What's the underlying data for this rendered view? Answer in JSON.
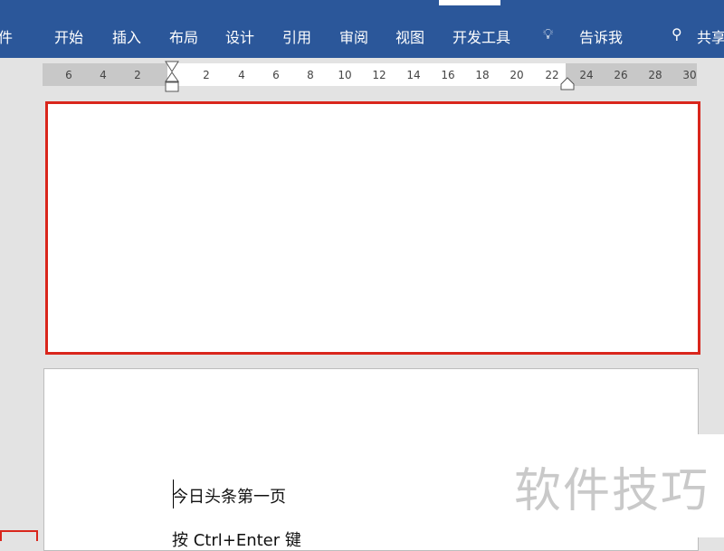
{
  "ribbon": {
    "tabs": [
      "件",
      "开始",
      "插入",
      "布局",
      "设计",
      "引用",
      "审阅",
      "视图",
      "开发工具"
    ],
    "tell_me": "告诉我",
    "share": "共享"
  },
  "ruler": {
    "ticks": [
      "6",
      "4",
      "2",
      "2",
      "4",
      "6",
      "8",
      "10",
      "12",
      "14",
      "16",
      "18",
      "20",
      "22",
      "24",
      "26",
      "28",
      "30"
    ]
  },
  "document": {
    "line1": "今日头条第一页",
    "line2": "按 Ctrl+Enter 键"
  },
  "watermark": "软件技巧",
  "colors": {
    "ribbon": "#2b579a",
    "highlight": "#d9261c"
  }
}
